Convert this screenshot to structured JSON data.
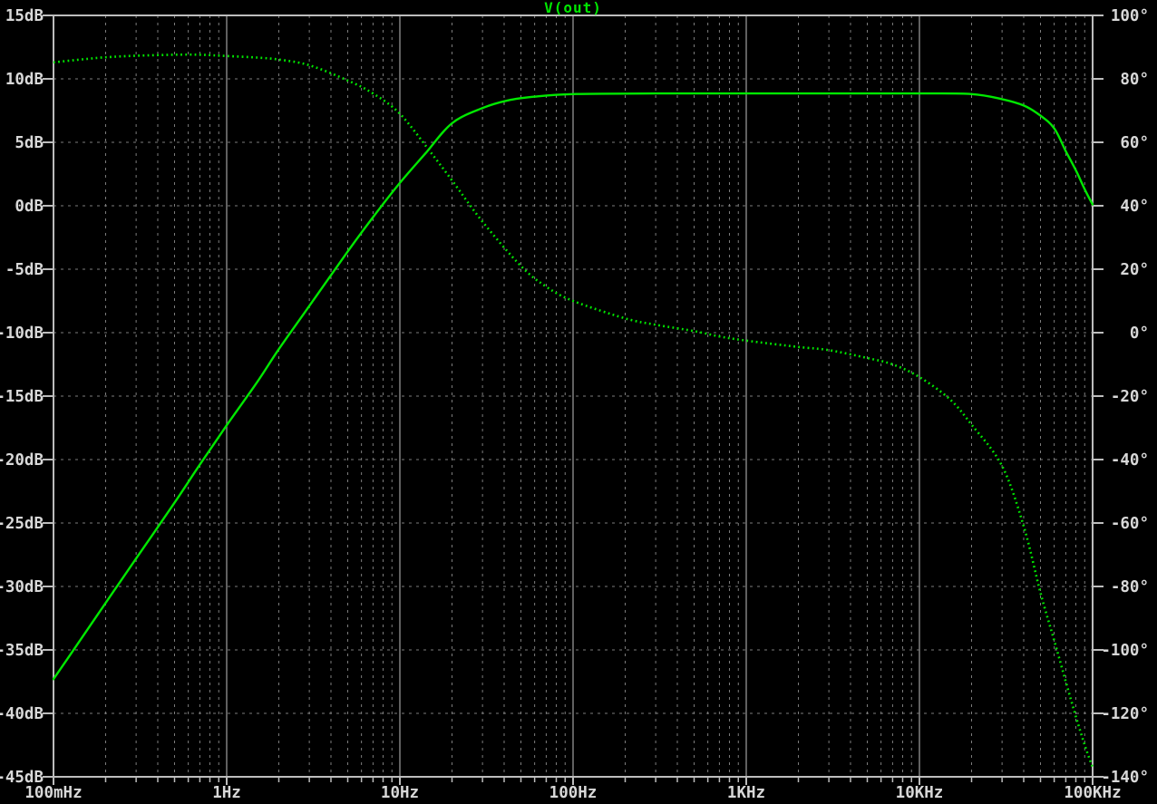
{
  "chart_data": {
    "type": "line",
    "title": "V(out)",
    "background_color": "#000000",
    "trace_color": "#00e800",
    "grid_color": "#7d7d7d",
    "axis_color": "#bdbdbd",
    "major_grid_color": "#8a8a8a",
    "label_color": "#d8d8d8",
    "x_axis": {
      "scale": "log",
      "unit": "Hz",
      "min_hz": 0.1,
      "max_hz": 100000,
      "tick_labels": [
        "100mHz",
        "1Hz",
        "10Hz",
        "100Hz",
        "1KHz",
        "10KHz",
        "100KHz"
      ]
    },
    "y_axis_left": {
      "unit": "dB",
      "min": -45,
      "max": 15,
      "step": 5,
      "tick_labels": [
        "15dB",
        "10dB",
        "5dB",
        "0dB",
        "-5dB",
        "-10dB",
        "-15dB",
        "-20dB",
        "-25dB",
        "-30dB",
        "-35dB",
        "-40dB",
        "-45dB"
      ]
    },
    "y_axis_right": {
      "unit": "deg",
      "min": -140,
      "max": 100,
      "step": 20,
      "tick_labels": [
        "100°",
        "80°",
        "60°",
        "40°",
        "20°",
        "0°",
        "-20°",
        "-40°",
        "-60°",
        "-80°",
        "-100°",
        "-120°",
        "-140°"
      ]
    },
    "legend_position": "top-center",
    "grid": true,
    "series": [
      {
        "name": "V(out) magnitude",
        "style": "solid",
        "axis": "left",
        "points_hz_db": [
          [
            0.1,
            -37.3
          ],
          [
            0.15,
            -33.8
          ],
          [
            0.2,
            -31.3
          ],
          [
            0.3,
            -27.8
          ],
          [
            0.5,
            -23.4
          ],
          [
            0.7,
            -20.4
          ],
          [
            1,
            -17.3
          ],
          [
            1.5,
            -13.9
          ],
          [
            2,
            -11.3
          ],
          [
            3,
            -7.9
          ],
          [
            5,
            -3.6
          ],
          [
            7,
            -0.9
          ],
          [
            10,
            1.8
          ],
          [
            14,
            4.1
          ],
          [
            20,
            6.5
          ],
          [
            30,
            7.7
          ],
          [
            42,
            8.3
          ],
          [
            60,
            8.6
          ],
          [
            100,
            8.8
          ],
          [
            300,
            8.85
          ],
          [
            1000,
            8.85
          ],
          [
            3000,
            8.85
          ],
          [
            10000,
            8.85
          ],
          [
            20000,
            8.8
          ],
          [
            30000,
            8.4
          ],
          [
            40000,
            7.9
          ],
          [
            50000,
            7.1
          ],
          [
            60000,
            6.1
          ],
          [
            70000,
            4.3
          ],
          [
            80000,
            2.8
          ],
          [
            90000,
            1.3
          ],
          [
            100000,
            0.1
          ]
        ]
      },
      {
        "name": "V(out) phase",
        "style": "dotted",
        "axis": "right",
        "points_hz_deg": [
          [
            0.1,
            85.2
          ],
          [
            0.15,
            86.2
          ],
          [
            0.2,
            86.8
          ],
          [
            0.3,
            87.3
          ],
          [
            0.5,
            87.6
          ],
          [
            0.7,
            87.6
          ],
          [
            1,
            87.2
          ],
          [
            1.5,
            86.7
          ],
          [
            2,
            86.1
          ],
          [
            3,
            84.3
          ],
          [
            5,
            79.5
          ],
          [
            7,
            75.4
          ],
          [
            10,
            69
          ],
          [
            15,
            57
          ],
          [
            20,
            48
          ],
          [
            30,
            35
          ],
          [
            50,
            21
          ],
          [
            70,
            14.5
          ],
          [
            100,
            10
          ],
          [
            200,
            4.5
          ],
          [
            300,
            2.5
          ],
          [
            500,
            0.5
          ],
          [
            700,
            -1.2
          ],
          [
            1000,
            -2.5
          ],
          [
            2000,
            -4.5
          ],
          [
            3000,
            -5.5
          ],
          [
            5000,
            -8
          ],
          [
            7000,
            -10
          ],
          [
            10000,
            -14
          ],
          [
            15000,
            -21
          ],
          [
            20000,
            -29
          ],
          [
            30000,
            -42
          ],
          [
            40000,
            -61
          ],
          [
            50000,
            -82
          ],
          [
            60000,
            -97
          ],
          [
            70000,
            -110
          ],
          [
            80000,
            -121
          ],
          [
            90000,
            -130
          ],
          [
            100000,
            -137
          ]
        ]
      }
    ]
  }
}
